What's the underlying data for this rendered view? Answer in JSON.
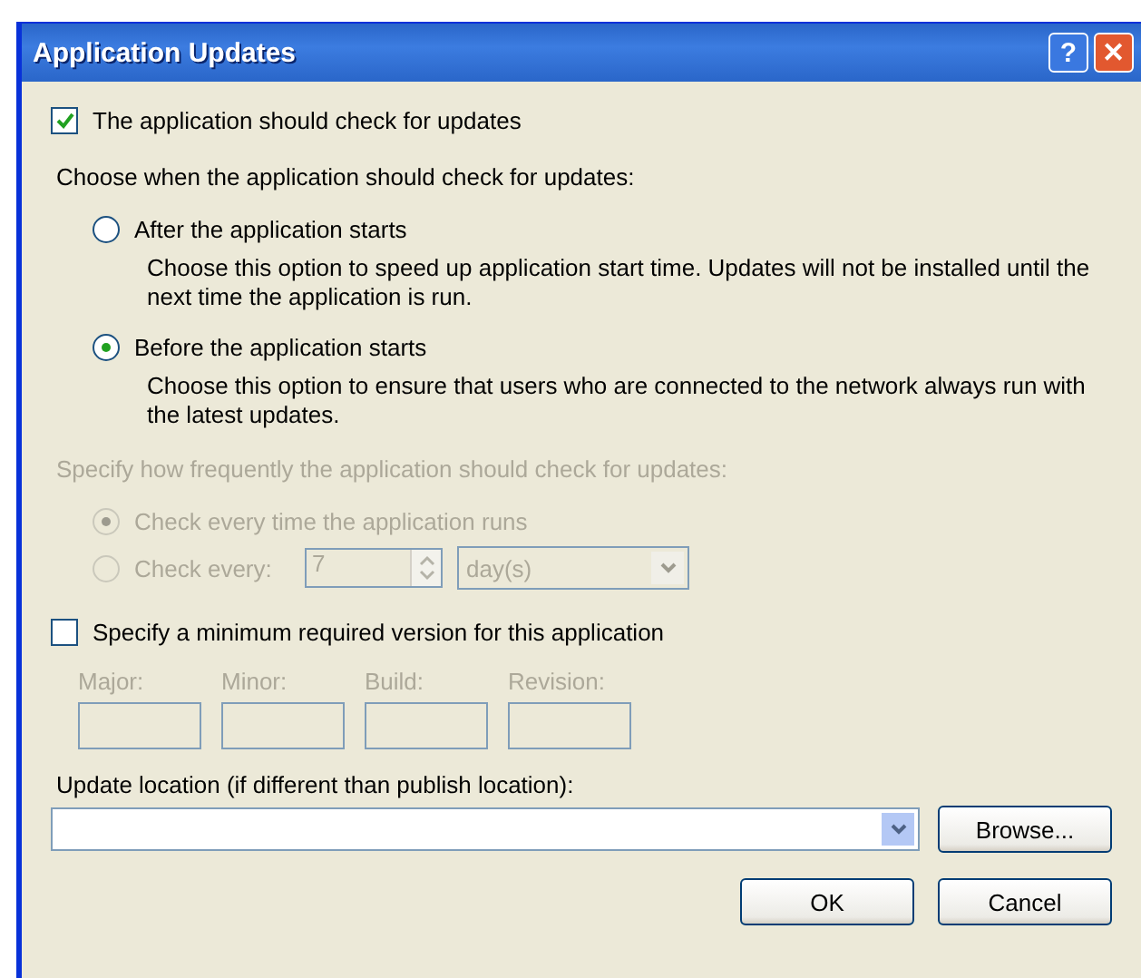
{
  "window": {
    "title": "Application Updates"
  },
  "title_buttons": [
    {
      "kind": "help",
      "label": "?"
    },
    {
      "kind": "close",
      "label": "✕"
    }
  ],
  "check_updates": {
    "label": "The application should check for updates",
    "checked": true
  },
  "when_heading": "Choose when the application should check for updates:",
  "when_options": [
    {
      "label": "After the application starts",
      "description": "Choose this option to speed up application start time. Updates will not be installed until the next time the application is run.",
      "selected": false
    },
    {
      "label": "Before the application starts",
      "description": "Choose this option to ensure that users who are connected to the network always run with the latest updates.",
      "selected": true
    }
  ],
  "frequency": {
    "heading": "Specify how frequently the application should check for updates:",
    "disabled": true,
    "options": [
      {
        "kind": "plain",
        "label": "Check every time the application runs",
        "selected": true
      },
      {
        "kind": "interval",
        "label": "Check every:",
        "selected": false,
        "interval_value": "7",
        "unit": "day(s)"
      }
    ]
  },
  "min_version": {
    "label": "Specify a minimum required version for this application",
    "checked": false,
    "disabled": true,
    "fields": [
      {
        "label": "Major:"
      },
      {
        "label": "Minor:"
      },
      {
        "label": "Build:"
      },
      {
        "label": "Revision:"
      }
    ]
  },
  "update_location": {
    "label": "Update location (if different than publish location):",
    "browse": "Browse..."
  },
  "buttons": [
    "OK",
    "Cancel"
  ]
}
